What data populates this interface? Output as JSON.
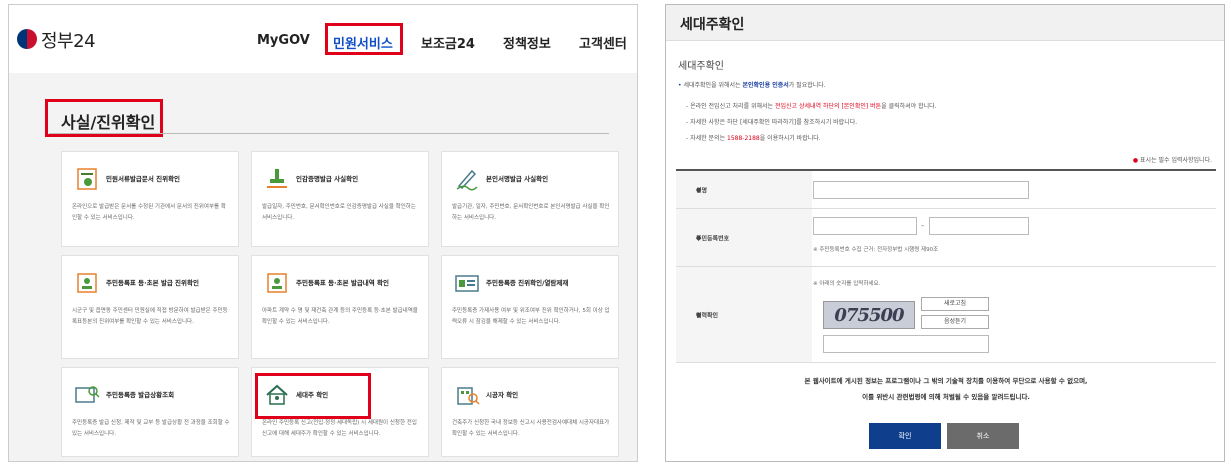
{
  "left": {
    "logo": "정부24",
    "nav": [
      "MyGOV",
      "민원서비스",
      "보조금24",
      "정책정보",
      "고객센터"
    ],
    "page_title": "사실/진위확인",
    "cards": [
      {
        "title": "민원서류발급문서 진위확인",
        "desc": "온라인으로 발급받은 문서를 수정된 기관에서 문서의 진위여부를 확인할 수 있는 서비스입니다."
      },
      {
        "title": "인감증명발급 사실확인",
        "desc": "발급일자, 주민번호, 문서확인번호로 인감증명발급 사실을 확인하는 서비스입니다."
      },
      {
        "title": "본인서명발급 사실확인",
        "desc": "발급기관, 일자, 주민번호, 문서확인번호로 본인서명발급 사실을 확인하는 서비스입니다."
      },
      {
        "title": "주민등록표 등·초본 발급 진위확인",
        "desc": "시군구 및 읍면동 주민센터 민원실에 직접 방문하여 발급받은 주민등록표등본의 진위여부를 확인할 수 있는 서비스입니다."
      },
      {
        "title": "주민등록표 등·초본 발급내역 확인",
        "desc": "아파트 계약 수 명 및 재건축 관계 등의 주민등록 등·초본 발급내역을 확인할 수 있는 서비스입니다."
      },
      {
        "title": "주민등록증 진위확인/열람제재",
        "desc": "주민등록증 가제사용 여부 및 위조여부 진위 확인하거나, 5회 이상 입력오류 시 잠김을 해제할 수 있는 서비스입니다."
      },
      {
        "title": "주민등록증 발급상황조회",
        "desc": "주민등록증 발급 신청, 제작 및 교부 등 발급상황 전 과정을 조회할 수 있는 서비스입니다."
      },
      {
        "title": "세대주 확인",
        "desc": "온라인 주민등록 신고(전입·정정·세대독립) 시 세대원이 신청한 전입신고에 대해 세대주가 확인할 수 있는 서비스입니다."
      },
      {
        "title": "시공자 확인",
        "desc": "건축주가 신청한 국내 정보등 신고시 사용전검사예대체 시공자대표가 확인할 수 있는 서비스입니다."
      }
    ]
  },
  "right": {
    "header_title": "세대주확인",
    "subtitle": "세대주확인",
    "notice1_a": "세대주확인을 위해서는",
    "notice1_b": "본인확인용 인증서",
    "notice1_c": "가 필요합니다.",
    "notice2_a": "- 온라인 전입신고 처리를 위해서는",
    "notice2_b": "전입신고 상세내역 하단의 [본인확인] 버튼",
    "notice2_c": "을 클릭하셔야 합니다.",
    "notice3": "- 자세한 사항은 하단 [세대주확인 따라하기]를 참조하시기 바랍니다.",
    "notice4_a": "- 자세한 문의는",
    "notice4_b": "1588-2188",
    "notice4_c": "을 이용하시기 바랍니다.",
    "required_mark": "●",
    "required_note": "표시는 필수 입력사항입니다.",
    "label_name": "성명",
    "label_rrn": "주민등록번호",
    "rrn_hint": "※ 주민등록번호 수집 근거: 전자정부법 시행령 제90조",
    "rrn_sep": "-",
    "label_captcha": "입력확인",
    "captcha_hint": "※ 아래의 숫자를 입력하세요.",
    "captcha_value": "075500",
    "refresh_label": "새로고침",
    "audio_label": "음성듣기",
    "footer1": "본 웹사이트에 게시된 정보는 프로그램이나 그 밖의 기술적 장치를 이용하여 무단으로 사용할 수 없으며,",
    "footer2": "이를 위반시 관련법령에 의해 처벌될 수 있음을 알려드립니다.",
    "confirm_label": "확인",
    "cancel_label": "취소",
    "colors": {
      "primary": "#0f3f8c",
      "secondary": "#6b6b6b",
      "highlight": "#e0001a"
    }
  }
}
